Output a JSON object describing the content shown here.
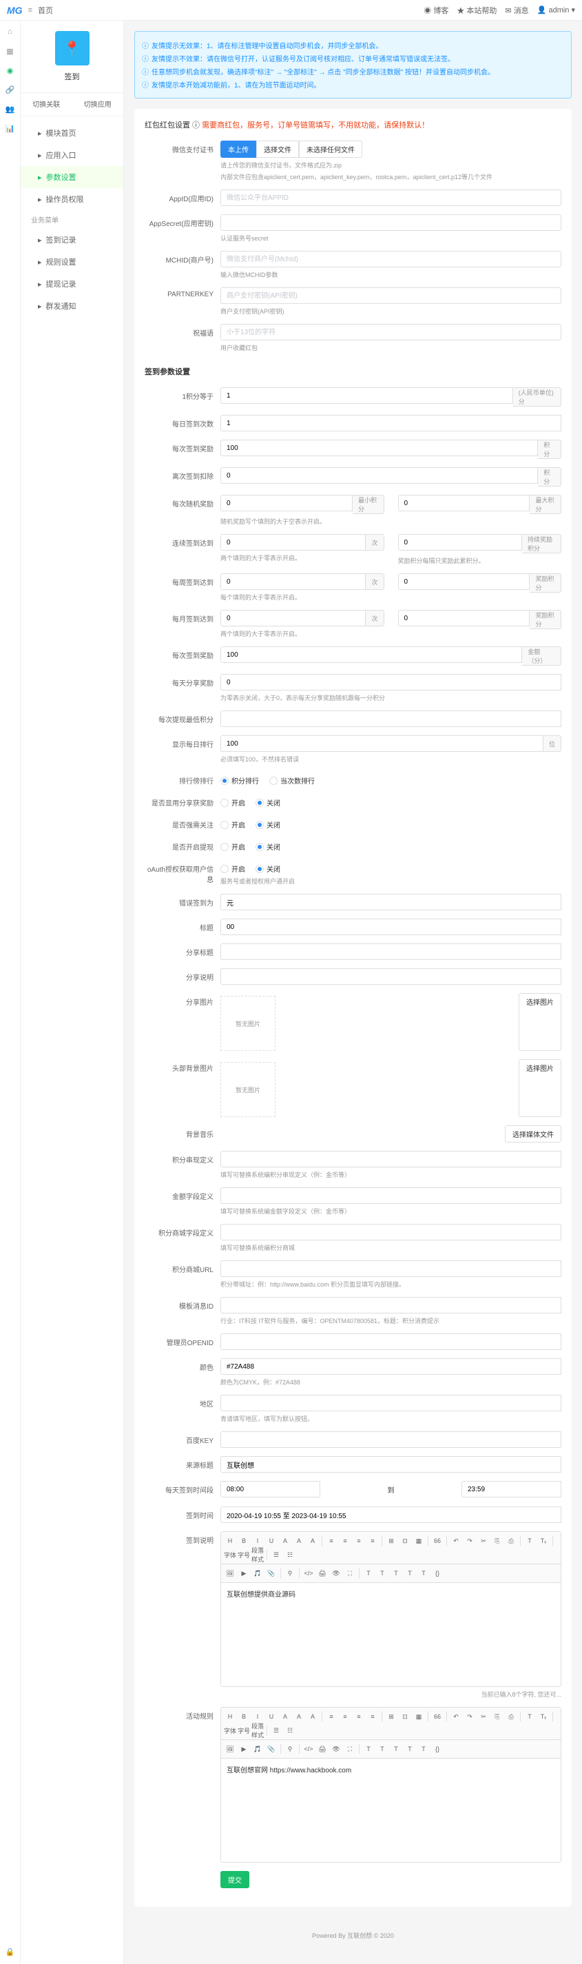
{
  "topbar": {
    "site": "首页",
    "links": [
      "博客",
      "本站帮助",
      "消息"
    ],
    "user": "admin"
  },
  "app": {
    "name": "签到"
  },
  "tabs": [
    "切换关联",
    "切换应用"
  ],
  "menu": {
    "groups": [
      {
        "label": "",
        "items": [
          {
            "label": "模块首页"
          },
          {
            "label": "应用入口"
          },
          {
            "label": "参数设置",
            "active": true
          },
          {
            "label": "操作员权限"
          }
        ]
      },
      {
        "label": "业务菜单",
        "items": [
          {
            "label": "签到记录"
          },
          {
            "label": "规则设置"
          },
          {
            "label": "提现记录"
          },
          {
            "label": "群发通知"
          }
        ]
      }
    ]
  },
  "alerts": [
    "友情提示无效果：1、请在标注管理中设置自动同步机会，并同步全部机会。",
    "友情提示不效果：请在微信号打开，认证服务号及订阅号核对相应、订单号通常填写错误或无法签。",
    "任意想同步机会就发现，确选择项\"标注\" → \"全部标注\" → 点击 \"同步全部标注数据\" 按钮！并设置自动同步机会。",
    "友情提示本开始减功能前，1、请在为班节面运动时间。"
  ],
  "panel1": {
    "title": "红包红包设置",
    "note": "需要商红包，服务号，订单号链需填写，不用就功能，请保持默认！",
    "certLabel": "微信支付证书",
    "certBtns": [
      "本上传",
      "选择文件",
      "未选择任何文件"
    ],
    "certHelp1": "请上传您的微信支付证书，文件格式应为.zip",
    "certHelp2": "内部文件应包含apiclient_cert.pem，apiclient_key.pem，rootca.pem，apiclient_cert.p12等几个文件",
    "appidLabel": "AppID(应用ID)",
    "appidPh": "微信公众平台APPID",
    "secretLabel": "AppSecret(应用密钥)",
    "secretHelp": "认证服务号secret",
    "mchidLabel": "MCHID(商户号)",
    "mchidPh": "微信支付商户号(MchId)",
    "mchidHelp": "输入微信MCHID参数",
    "keyLabel": "PARTNERKEY",
    "keyPh": "商户支付密钥(API密钥)",
    "keyHelp": "商户支付密钥(API密钥)",
    "wishLabel": "祝福语",
    "wishPh": "小于13位的字符",
    "wishHelp": "用户收藏红包"
  },
  "panel2": {
    "title": "签到参数设置",
    "rows": {
      "r1": {
        "label": "1积分等于",
        "val": "1",
        "addon": "(人民币单位) 分"
      },
      "r2": {
        "label": "每日签到次数",
        "val": "1"
      },
      "r3": {
        "label": "每次签到奖励",
        "val": "100",
        "addon": "积分"
      },
      "r4": {
        "label": "离次签到扣除",
        "val": "0",
        "addon": "积分"
      },
      "r5": {
        "label": "每次随机奖励",
        "left": "0",
        "leftAddon": "最小积分",
        "right": "0",
        "rightAddon": "最大积分",
        "help": "随机奖励写个填则的大于空表示开启。"
      },
      "r6": {
        "label": "连续签到达到",
        "left": "0",
        "leftAddon": "次",
        "right": "0",
        "rightAddon": "持续奖励积分",
        "helpL": "两个填则的大于零表示开启。",
        "helpR": "奖励积分每隔只奖励此累积分。"
      },
      "r7": {
        "label": "每周签到达到",
        "left": "0",
        "leftAddon": "次",
        "right": "0",
        "rightAddon": "奖励积分",
        "help": "每个填则的大于零表示开启。"
      },
      "r8": {
        "label": "每月签到达到",
        "left": "0",
        "leftAddon": "次",
        "right": "0",
        "rightAddon": "奖励积分",
        "help": "两个填则的大于零表示开启。"
      },
      "r9": {
        "label": "每次签到奖励",
        "val": "100",
        "addon": "金额（分）"
      },
      "r10": {
        "label": "每天分享奖励",
        "val": "0",
        "help": "为零表示关闭，大于0，表示每天分享奖励随机跟每一分积分"
      },
      "r11": {
        "label": "每次提现最低积分",
        "val": ""
      },
      "r12": {
        "label": "显示每日排行",
        "val": "100",
        "addon": "位",
        "help": "必须填写100，不然排名错误"
      },
      "r13": {
        "label": "排行傍排行",
        "opts": [
          "积分排行",
          "当次数排行"
        ]
      },
      "r14": {
        "label": "是否显用分享获奖励",
        "opts": [
          "开启",
          "关闭"
        ],
        "checked": 1
      },
      "r15": {
        "label": "是否强需关注",
        "opts": [
          "开启",
          "关闭"
        ],
        "checked": 1
      },
      "r16": {
        "label": "是否开启提现",
        "opts": [
          "开启",
          "关闭"
        ],
        "checked": 1
      },
      "r17": {
        "label": "oAuth授权获取用户信息",
        "opts": [
          "开启",
          "关闭"
        ],
        "checked": 1,
        "warn": "服务号或者授权用户通开启"
      },
      "r18": {
        "label": "错误签到为",
        "val": "元"
      },
      "r19": {
        "label": "标题",
        "val": "00"
      },
      "r20": {
        "label": "分享标题",
        "val": ""
      },
      "r21": {
        "label": "分享说明",
        "val": ""
      },
      "r22": {
        "label": "分享图片",
        "btn": "选择图片"
      },
      "r23": {
        "label": "头部背景图片",
        "btn": "选择图片"
      },
      "r24": {
        "label": "背景音乐",
        "btn": "选择媒体文件"
      },
      "r25": {
        "label": "积分串现定义",
        "help": "填写可替换系统编积分串现定义（例：金币等）"
      },
      "r26": {
        "label": "金额字段定义",
        "help": "填写可替换系统编金额字段定义（例：金币等）"
      },
      "r27": {
        "label": "积分商城字段定义",
        "help": "填写可替换系统编积分商城"
      },
      "r28": {
        "label": "积分商城URL",
        "help": "积分带城址：例：http://www.baidu.com 积分页面显填写内部链接。"
      },
      "r29": {
        "label": "模板消息ID",
        "help": "行业：IT科技 IT软件与服务，编号：OPENTM407800581，标题：积分消费提示"
      },
      "r30": {
        "label": "管理员OPENID",
        "val": ""
      },
      "r31": {
        "label": "颜色",
        "val": "#72A488",
        "help": "颜色为CMYK，例：#72A488"
      },
      "r32": {
        "label": "地区",
        "help": "青请填写地区，填写为默认按钮。"
      },
      "r33": {
        "label": "百度KEY",
        "val": ""
      },
      "r34": {
        "label": "来源标题",
        "val": "互联创想"
      },
      "r35": {
        "label": "每天签到时间段",
        "from": "08:00",
        "to": "23:59",
        "sep": "到"
      },
      "r36": {
        "label": "签到时间",
        "val": "2020-04-19 10:55 至 2023-04-19 10:55"
      }
    },
    "editor1": {
      "label": "签到说明",
      "content": "互联创想提供商业源码"
    },
    "editor2": {
      "label": "活动规则",
      "content": "互联创想官网 https://www.hackbook.com"
    },
    "editorTools": [
      "H",
      "B",
      "I",
      "U",
      "A",
      "A",
      "A",
      "—",
      "≡",
      "≡",
      "≡",
      "≡",
      "—",
      "⊞",
      "⊡",
      "▦",
      "—",
      "66",
      "—",
      "↶",
      "↷",
      "✂",
      "⎘",
      "⎙",
      "—",
      "T",
      "Tₓ",
      "—",
      "字体",
      "字号",
      "段落样式",
      "—",
      "☰",
      "☷"
    ],
    "editorTools2": [
      "🖼",
      "▶",
      "🎵",
      "📎",
      "—",
      "⚲",
      "—",
      "</>",
      "🖨",
      "👁",
      "⛶",
      "—",
      "T",
      "T",
      "T",
      "T",
      "T",
      "{}"
    ],
    "editorFooter": "当前已输入8个字符, 您还可..."
  },
  "submit": "提交",
  "footer": "Powered By 互联创想 © 2020"
}
